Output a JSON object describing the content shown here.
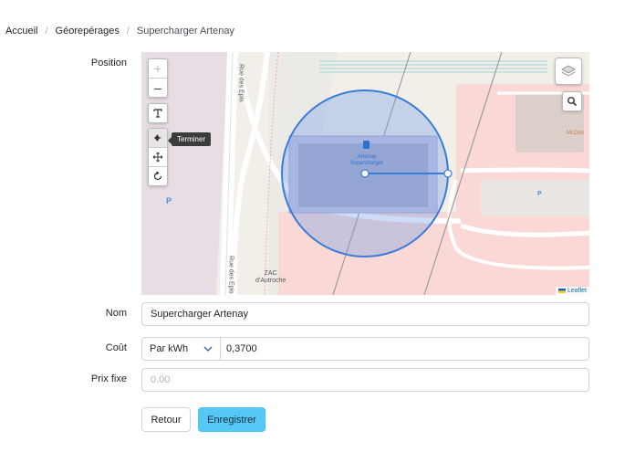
{
  "breadcrumb": {
    "items": [
      "Accueil",
      "Géorepérages",
      "Supercharger Artenay"
    ],
    "separator": "/"
  },
  "labels": {
    "position": "Position",
    "nom": "Nom",
    "cout": "Coût",
    "prix_fixe": "Prix fixe"
  },
  "map": {
    "controls": {
      "zoom_in": "+",
      "zoom_out": "–",
      "tooltip": "Terminer"
    },
    "streets": {
      "rue_des_epis_top": "Rue des Epis",
      "rue_des_epis_bottom": "Rue des Epis"
    },
    "places": {
      "station": [
        "Artenay",
        "Supercharger"
      ],
      "mcdo": "McDon",
      "zac": [
        "ZAC",
        "d'Autroche"
      ],
      "parking": "P"
    },
    "attribution": "Leaflet",
    "colors": {
      "circle_fill": "#6f9ee8",
      "circle_stroke": "#3a7bd8",
      "commercial_area": "#f9d8d6"
    }
  },
  "form": {
    "nom_value": "Supercharger Artenay",
    "cout_unit": "Par kWh",
    "cout_value": "0,3700",
    "prix_fixe_placeholder": "0.00"
  },
  "buttons": {
    "retour": "Retour",
    "enregistrer": "Enregistrer"
  }
}
